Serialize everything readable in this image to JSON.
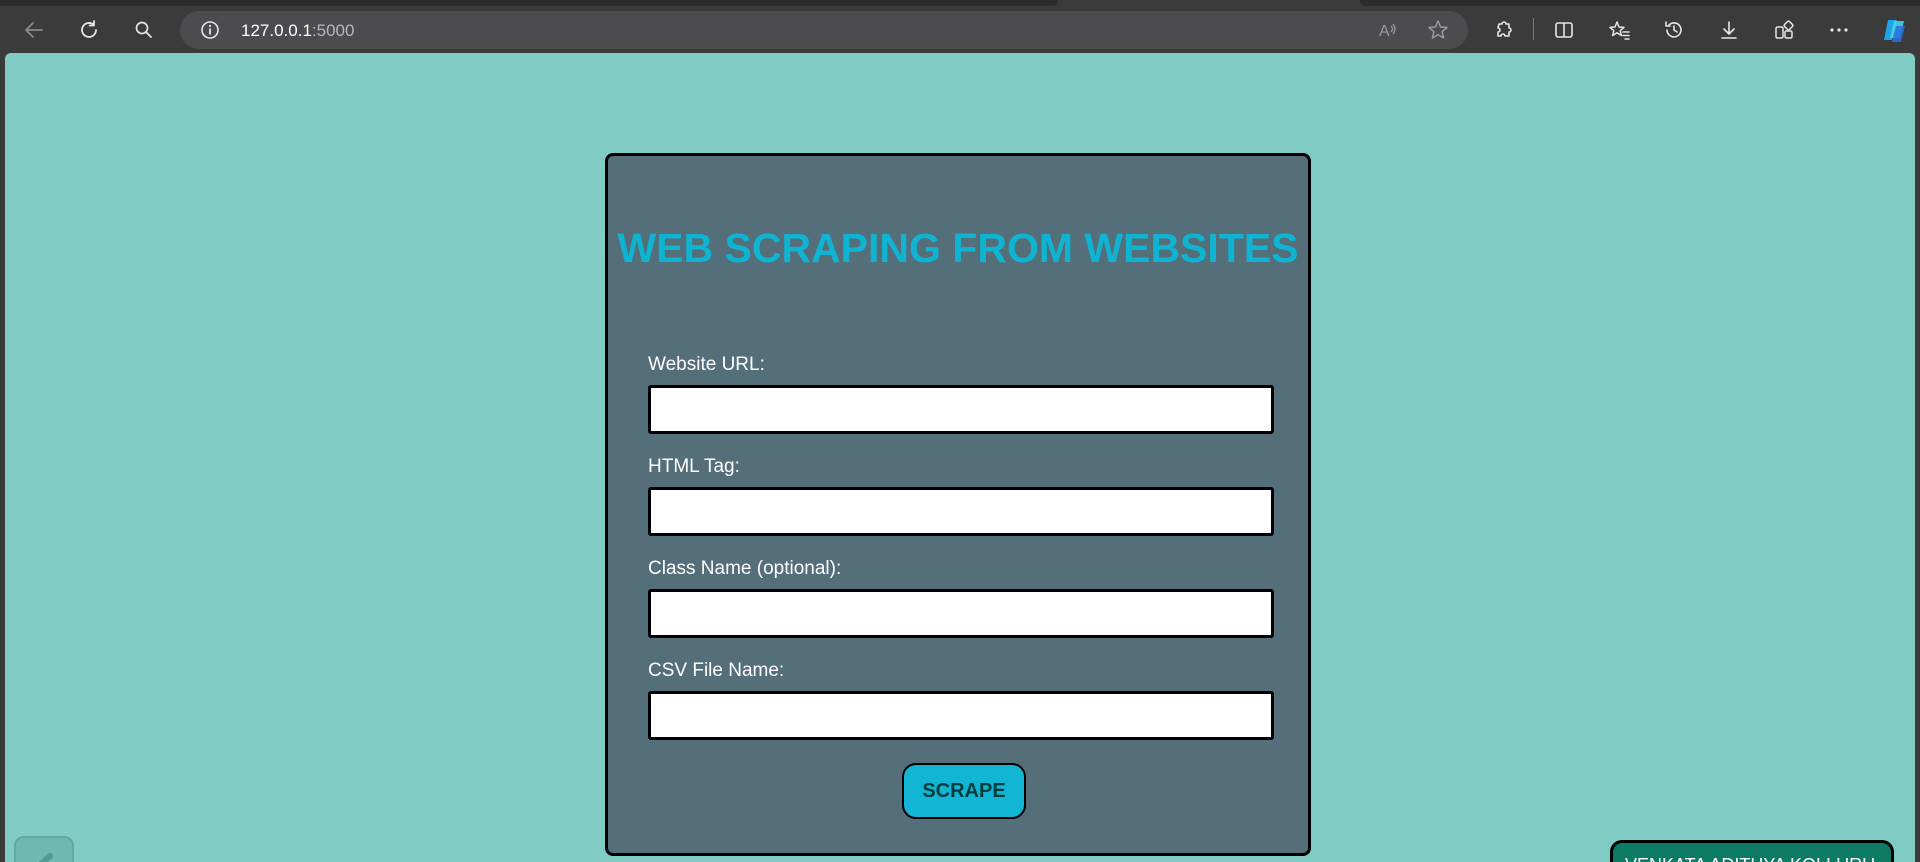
{
  "browser": {
    "url_host": "127.0.0.1",
    "url_port": ":5000",
    "icons": {
      "back": "back-arrow-icon",
      "refresh": "refresh-icon",
      "search": "search-icon",
      "site_info": "info-icon",
      "read_aloud": "read-aloud-icon",
      "favorite": "star-icon",
      "extensions": "extensions-icon",
      "split_screen": "split-screen-icon",
      "favorites": "favorites-icon",
      "history": "history-icon",
      "downloads": "download-icon",
      "collections": "collections-icon",
      "more": "more-icon",
      "copilot": "copilot-icon"
    }
  },
  "page": {
    "background_color": "#80cbc4",
    "card": {
      "title": "WEB SCRAPING FROM WEBSITES",
      "title_color": "#0eb4d2",
      "background_color": "#546e7a",
      "fields": [
        {
          "label": "Website URL:",
          "value": ""
        },
        {
          "label": "HTML Tag:",
          "value": ""
        },
        {
          "label": "Class Name (optional):",
          "value": ""
        },
        {
          "label": "CSV File Name:",
          "value": ""
        }
      ],
      "submit_label": "SCRAPE"
    },
    "corner_badge_text": "VENKATA ADITHYA KOLLURU"
  }
}
